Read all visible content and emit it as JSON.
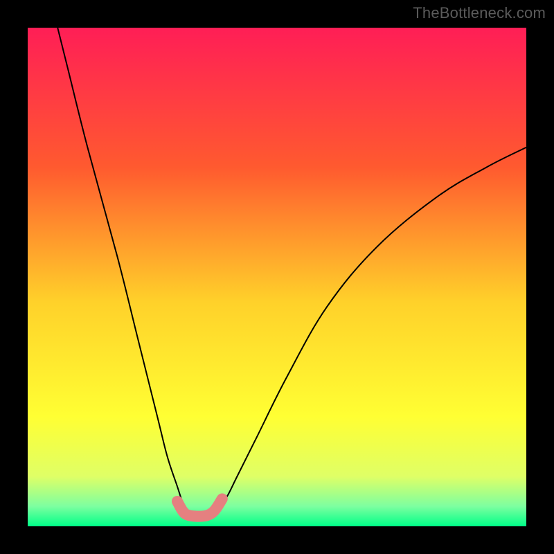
{
  "watermark": "TheBottleneck.com",
  "chart_data": {
    "type": "line",
    "title": "",
    "xlabel": "",
    "ylabel": "",
    "xlim": [
      0,
      100
    ],
    "ylim": [
      0,
      100
    ],
    "gradient_stops": [
      {
        "offset": 0,
        "color": "#ff1e56"
      },
      {
        "offset": 0.28,
        "color": "#ff5a2f"
      },
      {
        "offset": 0.55,
        "color": "#ffd12a"
      },
      {
        "offset": 0.78,
        "color": "#ffff33"
      },
      {
        "offset": 0.9,
        "color": "#dfff66"
      },
      {
        "offset": 0.96,
        "color": "#7dffa0"
      },
      {
        "offset": 1.0,
        "color": "#00ff88"
      }
    ],
    "series": [
      {
        "name": "curve",
        "style": "thin-black",
        "points": [
          {
            "x": 6,
            "y": 100
          },
          {
            "x": 8,
            "y": 92
          },
          {
            "x": 12,
            "y": 76
          },
          {
            "x": 18,
            "y": 54
          },
          {
            "x": 22,
            "y": 38
          },
          {
            "x": 26,
            "y": 22
          },
          {
            "x": 28,
            "y": 14
          },
          {
            "x": 30,
            "y": 8
          },
          {
            "x": 31,
            "y": 5
          },
          {
            "x": 32,
            "y": 3
          },
          {
            "x": 34,
            "y": 2
          },
          {
            "x": 36,
            "y": 2
          },
          {
            "x": 38,
            "y": 3
          },
          {
            "x": 40,
            "y": 6
          },
          {
            "x": 42,
            "y": 10
          },
          {
            "x": 46,
            "y": 18
          },
          {
            "x": 52,
            "y": 30
          },
          {
            "x": 60,
            "y": 44
          },
          {
            "x": 70,
            "y": 56
          },
          {
            "x": 82,
            "y": 66
          },
          {
            "x": 92,
            "y": 72
          },
          {
            "x": 100,
            "y": 76
          }
        ]
      },
      {
        "name": "bottleneck-highlight",
        "style": "thick-salmon",
        "points": [
          {
            "x": 28.5,
            "y": 9
          },
          {
            "x": 30,
            "y": 5
          },
          {
            "x": 31,
            "y": 3.2
          },
          {
            "x": 32,
            "y": 2.3
          },
          {
            "x": 34,
            "y": 2
          },
          {
            "x": 36,
            "y": 2.2
          },
          {
            "x": 37.5,
            "y": 3.2
          },
          {
            "x": 39,
            "y": 5.5
          },
          {
            "x": 40.5,
            "y": 9
          }
        ]
      }
    ],
    "highlight_gap_x": [
      29.2,
      29.6,
      39.3,
      39.7
    ]
  }
}
